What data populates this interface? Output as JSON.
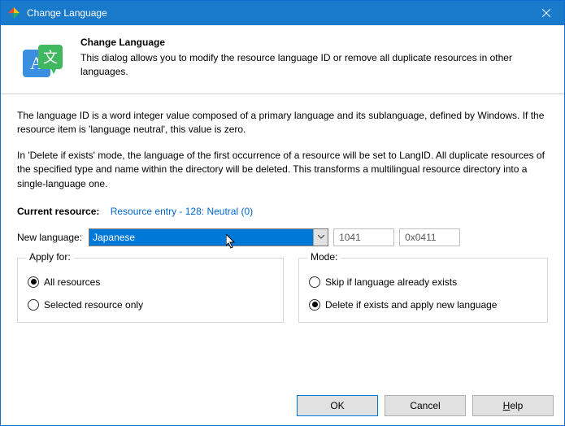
{
  "window": {
    "title": "Change Language"
  },
  "header": {
    "title": "Change Language",
    "description": "This dialog allows you to modify the resource language ID or remove all duplicate resources in other languages."
  },
  "body": {
    "para1": "The language ID is a word integer value composed of a primary language and its sublanguage, defined by Windows. If the resource item is 'language neutral', this value is zero.",
    "para2": "In 'Delete if exists' mode, the language of the first occurrence of a resource will be set to LangID. All duplicate resources of the specified type and name within the directory will be deleted. This transforms a multilingual resource directory into a single-language one.",
    "current_resource_label": "Current resource:",
    "current_resource_link": "Resource entry - 128: Neutral (0)",
    "new_language_label": "New language:",
    "new_language_value": "Japanese",
    "lang_id_dec": "1041",
    "lang_id_hex": "0x0411",
    "apply_group": {
      "label": "Apply for:",
      "options": {
        "all": "All resources",
        "selected": "Selected resource only"
      },
      "selected": "all"
    },
    "mode_group": {
      "label": "Mode:",
      "options": {
        "skip": "Skip if language already exists",
        "delete": "Delete if exists and apply new language"
      },
      "selected": "delete"
    }
  },
  "buttons": {
    "ok": "OK",
    "cancel": "Cancel",
    "help": "Help"
  }
}
